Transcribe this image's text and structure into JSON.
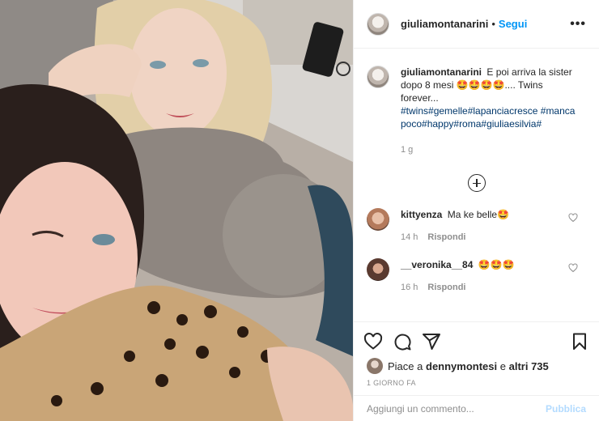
{
  "post": {
    "username": "giuliamontanarini",
    "separator": "•",
    "follow_label": "Segui",
    "more_label": "•••",
    "caption_user": "giuliamontanarini",
    "caption_text": "E poi arriva la sister dopo 8 mesi 🤩🤩🤩🤩.... Twins forever...",
    "caption_tags": "#twins#gemelle#lapanciacresce #mancapoco#happy#roma#giuliaesilvia#",
    "caption_time": "1 g"
  },
  "comments": [
    {
      "user": "kittyenza",
      "text": "Ma ke belle🤩",
      "time": "14 h",
      "reply": "Rispondi"
    },
    {
      "user": "__veronika__84",
      "text": "🤩🤩🤩",
      "time": "16 h",
      "reply": "Rispondi"
    }
  ],
  "likes": {
    "prefix": "Piace a",
    "user": "dennymontesi",
    "middle": "e",
    "others": "altri 735"
  },
  "date_label": "1 GIORNO FA",
  "composer": {
    "placeholder": "Aggiungi un commento...",
    "publish_label": "Pubblica"
  },
  "colors": {
    "link_blue": "#0095f6",
    "hashtag": "#00376b",
    "publish_disabled": "#b3dbff"
  }
}
